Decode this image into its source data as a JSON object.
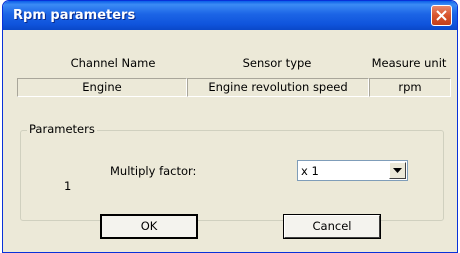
{
  "window": {
    "title": "Rpm parameters"
  },
  "table": {
    "headers": [
      "Channel Name",
      "Sensor type",
      "Measure unit"
    ],
    "row": [
      "Engine",
      "Engine revolution speed",
      "rpm"
    ]
  },
  "parameters": {
    "legend": "Parameters",
    "index": "1",
    "label": "Multiply factor:",
    "selected_value": "x 1"
  },
  "buttons": {
    "ok": "OK",
    "cancel": "Cancel"
  },
  "colors": {
    "titlebar": "#0a5ee8",
    "close": "#d8542c",
    "face": "#ece9d8"
  }
}
